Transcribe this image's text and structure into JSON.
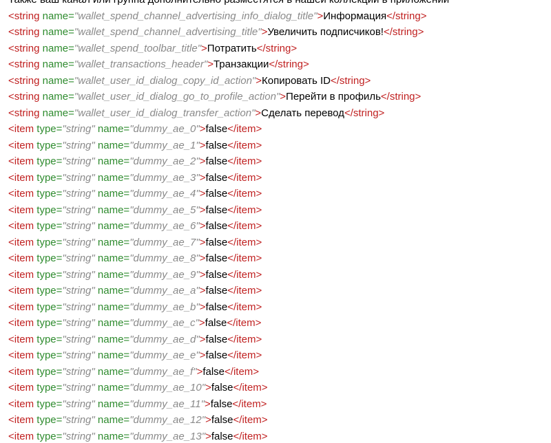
{
  "lines": [
    {
      "kind": "text",
      "content": "Также ваш канал или группа дополнительно разместятся в нашей коллекции в приложении"
    },
    {
      "kind": "string",
      "name": "wallet_spend_channel_advertising_info_dialog_title",
      "text": "Информация"
    },
    {
      "kind": "string",
      "name": "wallet_spend_channel_advertising_title",
      "text": "Увеличить подписчиков!"
    },
    {
      "kind": "string",
      "name": "wallet_spend_toolbar_title",
      "text": "Потратить"
    },
    {
      "kind": "string",
      "name": "wallet_transactions_header",
      "text": "Транзакции"
    },
    {
      "kind": "string",
      "name": "wallet_user_id_dialog_copy_id_action",
      "text": "Копировать ID"
    },
    {
      "kind": "string",
      "name": "wallet_user_id_dialog_go_to_profile_action",
      "text": "Перейти в профиль"
    },
    {
      "kind": "string",
      "name": "wallet_user_id_dialog_transfer_action",
      "text": "Сделать перевод"
    },
    {
      "kind": "item",
      "type": "string",
      "name": "dummy_ae_0",
      "text": "false"
    },
    {
      "kind": "item",
      "type": "string",
      "name": "dummy_ae_1",
      "text": "false"
    },
    {
      "kind": "item",
      "type": "string",
      "name": "dummy_ae_2",
      "text": "false"
    },
    {
      "kind": "item",
      "type": "string",
      "name": "dummy_ae_3",
      "text": "false"
    },
    {
      "kind": "item",
      "type": "string",
      "name": "dummy_ae_4",
      "text": "false"
    },
    {
      "kind": "item",
      "type": "string",
      "name": "dummy_ae_5",
      "text": "false"
    },
    {
      "kind": "item",
      "type": "string",
      "name": "dummy_ae_6",
      "text": "false"
    },
    {
      "kind": "item",
      "type": "string",
      "name": "dummy_ae_7",
      "text": "false"
    },
    {
      "kind": "item",
      "type": "string",
      "name": "dummy_ae_8",
      "text": "false"
    },
    {
      "kind": "item",
      "type": "string",
      "name": "dummy_ae_9",
      "text": "false"
    },
    {
      "kind": "item",
      "type": "string",
      "name": "dummy_ae_a",
      "text": "false"
    },
    {
      "kind": "item",
      "type": "string",
      "name": "dummy_ae_b",
      "text": "false"
    },
    {
      "kind": "item",
      "type": "string",
      "name": "dummy_ae_c",
      "text": "false"
    },
    {
      "kind": "item",
      "type": "string",
      "name": "dummy_ae_d",
      "text": "false"
    },
    {
      "kind": "item",
      "type": "string",
      "name": "dummy_ae_e",
      "text": "false"
    },
    {
      "kind": "item",
      "type": "string",
      "name": "dummy_ae_f",
      "text": "false"
    },
    {
      "kind": "item",
      "type": "string",
      "name": "dummy_ae_10",
      "text": "false"
    },
    {
      "kind": "item",
      "type": "string",
      "name": "dummy_ae_11",
      "text": "false"
    },
    {
      "kind": "item",
      "type": "string",
      "name": "dummy_ae_12",
      "text": "false"
    },
    {
      "kind": "item",
      "type": "string",
      "name": "dummy_ae_13",
      "text": "false"
    }
  ],
  "syntax_colors": {
    "tag": "#c02020",
    "attribute": "#2e8b2e",
    "attribute_value": "#8a8a8a",
    "text": "#000000",
    "background": "#ffffff"
  }
}
